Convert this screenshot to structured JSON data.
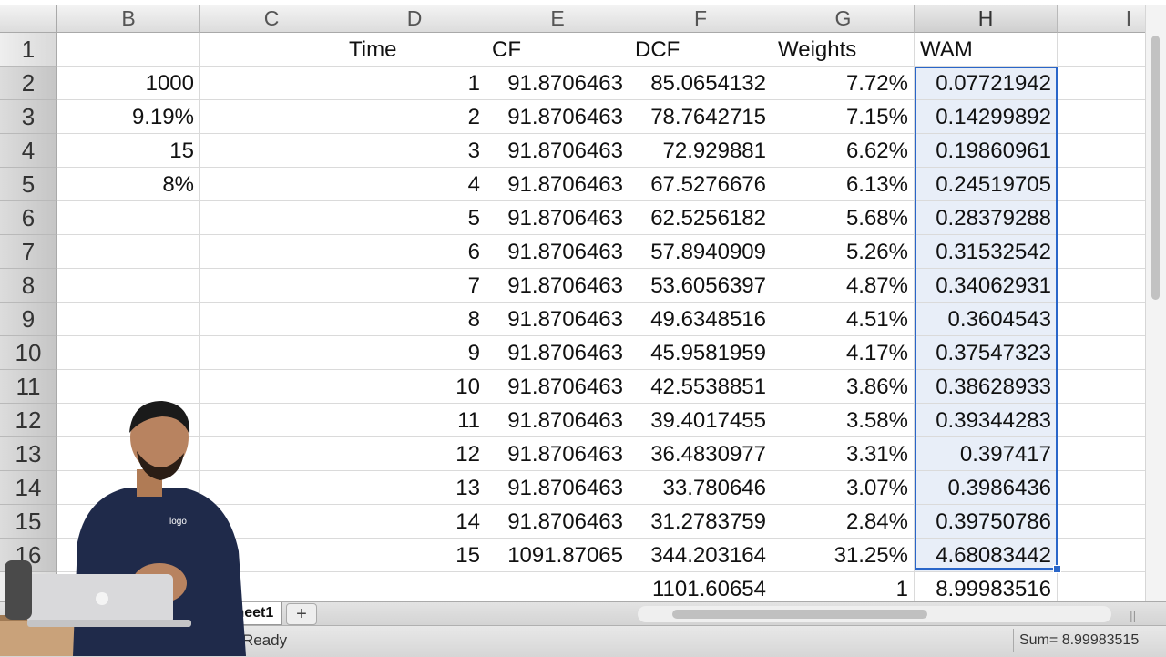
{
  "columns": [
    "B",
    "C",
    "D",
    "E",
    "F",
    "G",
    "H",
    "I"
  ],
  "selected_column": "H",
  "rows": [
    "1",
    "2",
    "3",
    "4",
    "5",
    "6",
    "7",
    "8",
    "9",
    "10",
    "11",
    "12",
    "13",
    "14",
    "15",
    "16"
  ],
  "cells": {
    "B": [
      "",
      "1000",
      "9.19%",
      "15",
      "8%",
      "",
      "",
      "",
      "",
      "",
      "",
      "",
      "",
      "",
      "",
      "",
      ""
    ],
    "D": [
      "Time",
      "1",
      "2",
      "3",
      "4",
      "5",
      "6",
      "7",
      "8",
      "9",
      "10",
      "11",
      "12",
      "13",
      "14",
      "15",
      ""
    ],
    "E": [
      "CF",
      "91.8706463",
      "91.8706463",
      "91.8706463",
      "91.8706463",
      "91.8706463",
      "91.8706463",
      "91.8706463",
      "91.8706463",
      "91.8706463",
      "91.8706463",
      "91.8706463",
      "91.8706463",
      "91.8706463",
      "91.8706463",
      "1091.87065",
      ""
    ],
    "F": [
      "DCF",
      "85.0654132",
      "78.7642715",
      "72.929881",
      "67.5276676",
      "62.5256182",
      "57.8940909",
      "53.6056397",
      "49.6348516",
      "45.9581959",
      "42.5538851",
      "39.4017455",
      "36.4830977",
      "33.780646",
      "31.2783759",
      "344.203164",
      "1101.60654"
    ],
    "G": [
      "Weights",
      "7.72%",
      "7.15%",
      "6.62%",
      "6.13%",
      "5.68%",
      "5.26%",
      "4.87%",
      "4.51%",
      "4.17%",
      "3.86%",
      "3.58%",
      "3.31%",
      "3.07%",
      "2.84%",
      "31.25%",
      "1"
    ],
    "H": [
      "WAM",
      "0.07721942",
      "0.14299892",
      "0.19860961",
      "0.24519705",
      "0.28379288",
      "0.31532542",
      "0.34062931",
      "0.3604543",
      "0.37547323",
      "0.38628933",
      "0.39344283",
      "0.397417",
      "0.3986436",
      "0.39750786",
      "4.68083442",
      "8.99983516"
    ]
  },
  "sheet_tab": {
    "label": "Sheet1",
    "add_label": "+"
  },
  "status": {
    "ready": "Ready",
    "sum": "Sum= 8.99983515"
  },
  "colors": {
    "selection": "#2a66c9",
    "selection_fill": "#e8eef8"
  }
}
